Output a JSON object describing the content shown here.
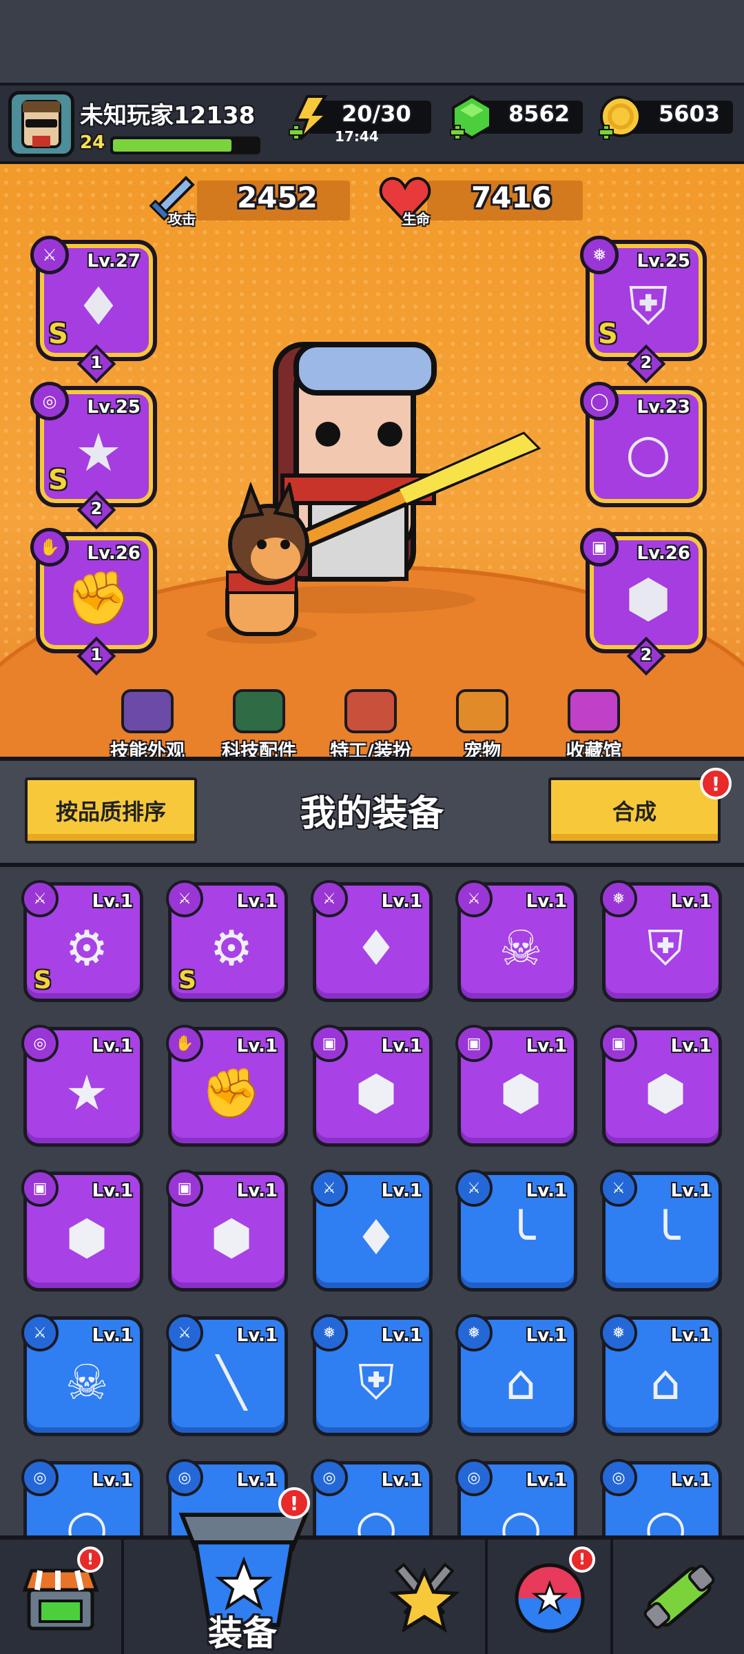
{
  "player": {
    "name": "未知玩家12138",
    "level": "24",
    "xp_fraction": 0.82
  },
  "resources": {
    "energy": {
      "value": "20/30",
      "timer": "17:44"
    },
    "gems": {
      "value": "8562"
    },
    "coins": {
      "value": "5603"
    }
  },
  "stats": {
    "attack": {
      "label": "攻击",
      "value": "2452"
    },
    "hp": {
      "label": "生命",
      "value": "7416"
    }
  },
  "equipped": [
    {
      "slot": "weapon",
      "level": "Lv.27",
      "rank": "S",
      "stars": "1"
    },
    {
      "slot": "necklace",
      "level": "Lv.25",
      "rank": "S",
      "stars": "2"
    },
    {
      "slot": "gloves",
      "level": "Lv.26",
      "rank": "",
      "stars": "1"
    },
    {
      "slot": "armor",
      "level": "Lv.25",
      "rank": "S",
      "stars": "2"
    },
    {
      "slot": "belt",
      "level": "Lv.23",
      "rank": "",
      "stars": ""
    },
    {
      "slot": "boots",
      "level": "Lv.26",
      "rank": "",
      "stars": "2"
    }
  ],
  "hero_tabs": [
    {
      "label": "技能外观",
      "color": "#6b4aa8"
    },
    {
      "label": "科技配件",
      "color": "#2f6b44"
    },
    {
      "label": "特工/装扮",
      "color": "#c9503a"
    },
    {
      "label": "宠物",
      "color": "#e08a2a"
    },
    {
      "label": "收藏馆",
      "color": "#c040c8"
    }
  ],
  "equipment_header": {
    "sort_button": "按品质排序",
    "title": "我的装备",
    "merge_button": "合成",
    "merge_alert": "!"
  },
  "inventory": [
    {
      "rarity": "p",
      "type": "weapon",
      "level": "Lv.1",
      "rank": "S",
      "item": "blaster"
    },
    {
      "rarity": "p",
      "type": "weapon",
      "level": "Lv.1",
      "rank": "S",
      "item": "blaster"
    },
    {
      "rarity": "p",
      "type": "weapon",
      "level": "Lv.1",
      "rank": "",
      "item": "kunai"
    },
    {
      "rarity": "p",
      "type": "weapon",
      "level": "Lv.1",
      "rank": "",
      "item": "revolver"
    },
    {
      "rarity": "p",
      "type": "armor",
      "level": "Lv.1",
      "rank": "",
      "item": "vest"
    },
    {
      "rarity": "p",
      "type": "necklace",
      "level": "Lv.1",
      "rank": "",
      "item": "badge"
    },
    {
      "rarity": "p",
      "type": "gloves",
      "level": "Lv.1",
      "rank": "",
      "item": "gauntlet"
    },
    {
      "rarity": "p",
      "type": "boots",
      "level": "Lv.1",
      "rank": "",
      "item": "boot"
    },
    {
      "rarity": "p",
      "type": "boots",
      "level": "Lv.1",
      "rank": "",
      "item": "boot"
    },
    {
      "rarity": "p",
      "type": "boots",
      "level": "Lv.1",
      "rank": "",
      "item": "boot"
    },
    {
      "rarity": "p",
      "type": "boots",
      "level": "Lv.1",
      "rank": "",
      "item": "boot"
    },
    {
      "rarity": "p",
      "type": "boots",
      "level": "Lv.1",
      "rank": "",
      "item": "boot"
    },
    {
      "rarity": "b",
      "type": "weapon",
      "level": "Lv.1",
      "rank": "",
      "item": "kunai"
    },
    {
      "rarity": "b",
      "type": "weapon",
      "level": "Lv.1",
      "rank": "",
      "item": "katana"
    },
    {
      "rarity": "b",
      "type": "weapon",
      "level": "Lv.1",
      "rank": "",
      "item": "katana"
    },
    {
      "rarity": "b",
      "type": "weapon",
      "level": "Lv.1",
      "rank": "",
      "item": "revolver"
    },
    {
      "rarity": "b",
      "type": "weapon",
      "level": "Lv.1",
      "rank": "",
      "item": "bat"
    },
    {
      "rarity": "b",
      "type": "armor",
      "level": "Lv.1",
      "rank": "",
      "item": "vest"
    },
    {
      "rarity": "b",
      "type": "armor",
      "level": "Lv.1",
      "rank": "",
      "item": "shirt"
    },
    {
      "rarity": "b",
      "type": "armor",
      "level": "Lv.1",
      "rank": "",
      "item": "shirt"
    },
    {
      "rarity": "b",
      "type": "necklace",
      "level": "Lv.1",
      "rank": "",
      "item": "ring"
    },
    {
      "rarity": "b",
      "type": "necklace",
      "level": "Lv.1",
      "rank": "",
      "item": "ring"
    },
    {
      "rarity": "b",
      "type": "necklace",
      "level": "Lv.1",
      "rank": "",
      "item": "ring"
    },
    {
      "rarity": "b",
      "type": "necklace",
      "level": "Lv.1",
      "rank": "",
      "item": "ring"
    },
    {
      "rarity": "b",
      "type": "necklace",
      "level": "Lv.1",
      "rank": "",
      "item": "ring"
    }
  ],
  "bottom_nav": [
    {
      "id": "shop",
      "icon": "shop-icon",
      "alert": "!"
    },
    {
      "id": "equip",
      "label": "装备",
      "icon": "equipment-icon",
      "alert": "!"
    },
    {
      "id": "battle",
      "icon": "battle-icon"
    },
    {
      "id": "gacha",
      "icon": "orb-icon",
      "alert": "!"
    },
    {
      "id": "gene",
      "icon": "capsule-icon"
    }
  ],
  "colors": {
    "epic": "#a841e6",
    "rare": "#2f7ef2",
    "accent": "#f7c93a",
    "hero_bg": "#f29a2a"
  }
}
